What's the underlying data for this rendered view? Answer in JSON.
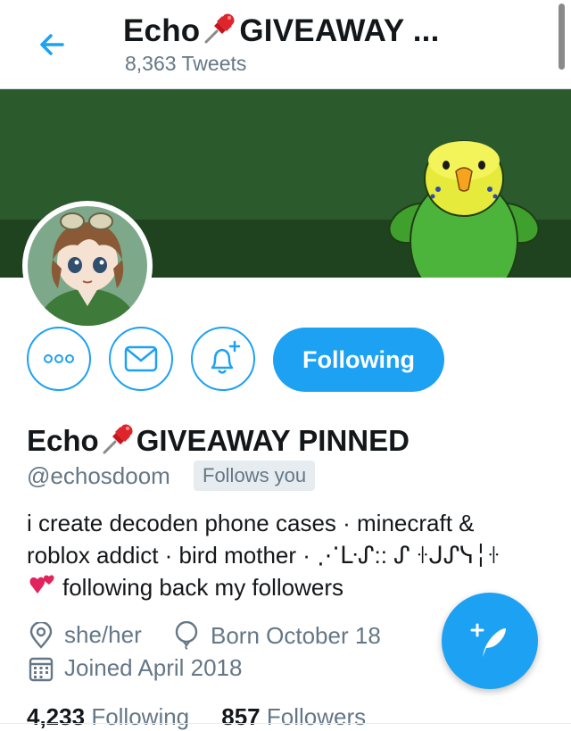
{
  "header": {
    "title_prefix": "Echo",
    "title_suffix": "GIVEAWAY ...",
    "tweet_count": "8,363 Tweets"
  },
  "actions": {
    "follow_label": "Following"
  },
  "profile": {
    "name_prefix": "Echo",
    "name_suffix": "GIVEAWAY PINNED",
    "handle": "@echosdoom",
    "follows_you": "Follows you",
    "bio_line1": "i create decoden phone cases · minecraft &",
    "bio_line2": "roblox addict · bird mother · ⋰ᒷᔑ:: ᔑ ꖌᒍᔑᓭ╎ꖌ",
    "bio_line3": "following back my followers",
    "pronouns": "she/her",
    "birthday": "Born October 18",
    "joined": "Joined April 2018"
  },
  "stats": {
    "following_count": "4,233",
    "following_label": "Following",
    "followers_count": "857",
    "followers_label": "Followers"
  },
  "colors": {
    "accent": "#1da1f2",
    "banner": "#2b5a2c",
    "muted_text": "#657786"
  },
  "icons": [
    "back-arrow-icon",
    "pushpin-icon",
    "more-icon",
    "mail-icon",
    "notification-bell-icon",
    "location-icon",
    "birthday-balloon-icon",
    "calendar-icon",
    "compose-tweet-icon",
    "heart-icon"
  ]
}
